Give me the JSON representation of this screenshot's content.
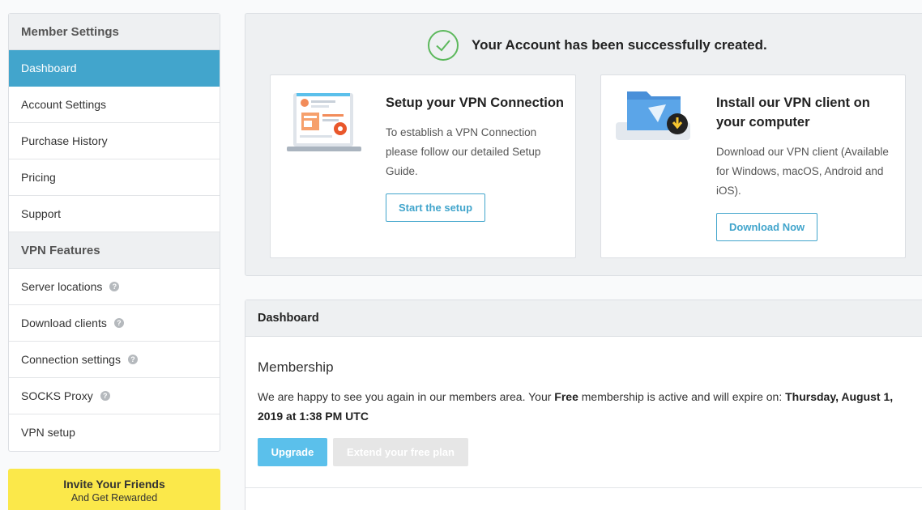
{
  "sidebar": {
    "member_settings_header": "Member Settings",
    "member_items": [
      {
        "label": "Dashboard",
        "active": true
      },
      {
        "label": "Account Settings"
      },
      {
        "label": "Purchase History"
      },
      {
        "label": "Pricing"
      },
      {
        "label": "Support"
      }
    ],
    "vpn_features_header": "VPN Features",
    "vpn_items": [
      {
        "label": "Server locations",
        "help": "?"
      },
      {
        "label": "Download clients",
        "help": "?"
      },
      {
        "label": "Connection settings",
        "help": "?"
      },
      {
        "label": "SOCKS Proxy",
        "help": "?"
      },
      {
        "label": "VPN setup"
      }
    ]
  },
  "invite": {
    "title": "Invite Your Friends",
    "subtitle": "And Get Rewarded"
  },
  "success": {
    "message": "Your Account has been successfully created."
  },
  "cards": [
    {
      "title": "Setup your VPN Connection",
      "description": "To establish a VPN Connection please follow our detailed Setup Guide.",
      "button": "Start the setup",
      "icon": "laptop-setup-illustration"
    },
    {
      "title": "Install our VPN client on your computer",
      "description": "Download our VPN client (Available for Windows, macOS, Android and iOS).",
      "button": "Download Now",
      "icon": "folder-download-illustration"
    }
  ],
  "dashboard": {
    "header": "Dashboard",
    "membership_title": "Membership",
    "text_before": "We are happy to see you again in our members area. Your ",
    "plan": "Free",
    "text_middle": " membership is active and will expire on: ",
    "expiry": "Thursday, August 1, 2019 at 1:38 PM UTC",
    "upgrade_button": "Upgrade",
    "extend_button": "Extend your free plan"
  },
  "colors": {
    "accent": "#42a5cc",
    "success": "#5cb85c",
    "invite_bg": "#fbe84a",
    "upgrade_bg": "#5bc0eb"
  }
}
